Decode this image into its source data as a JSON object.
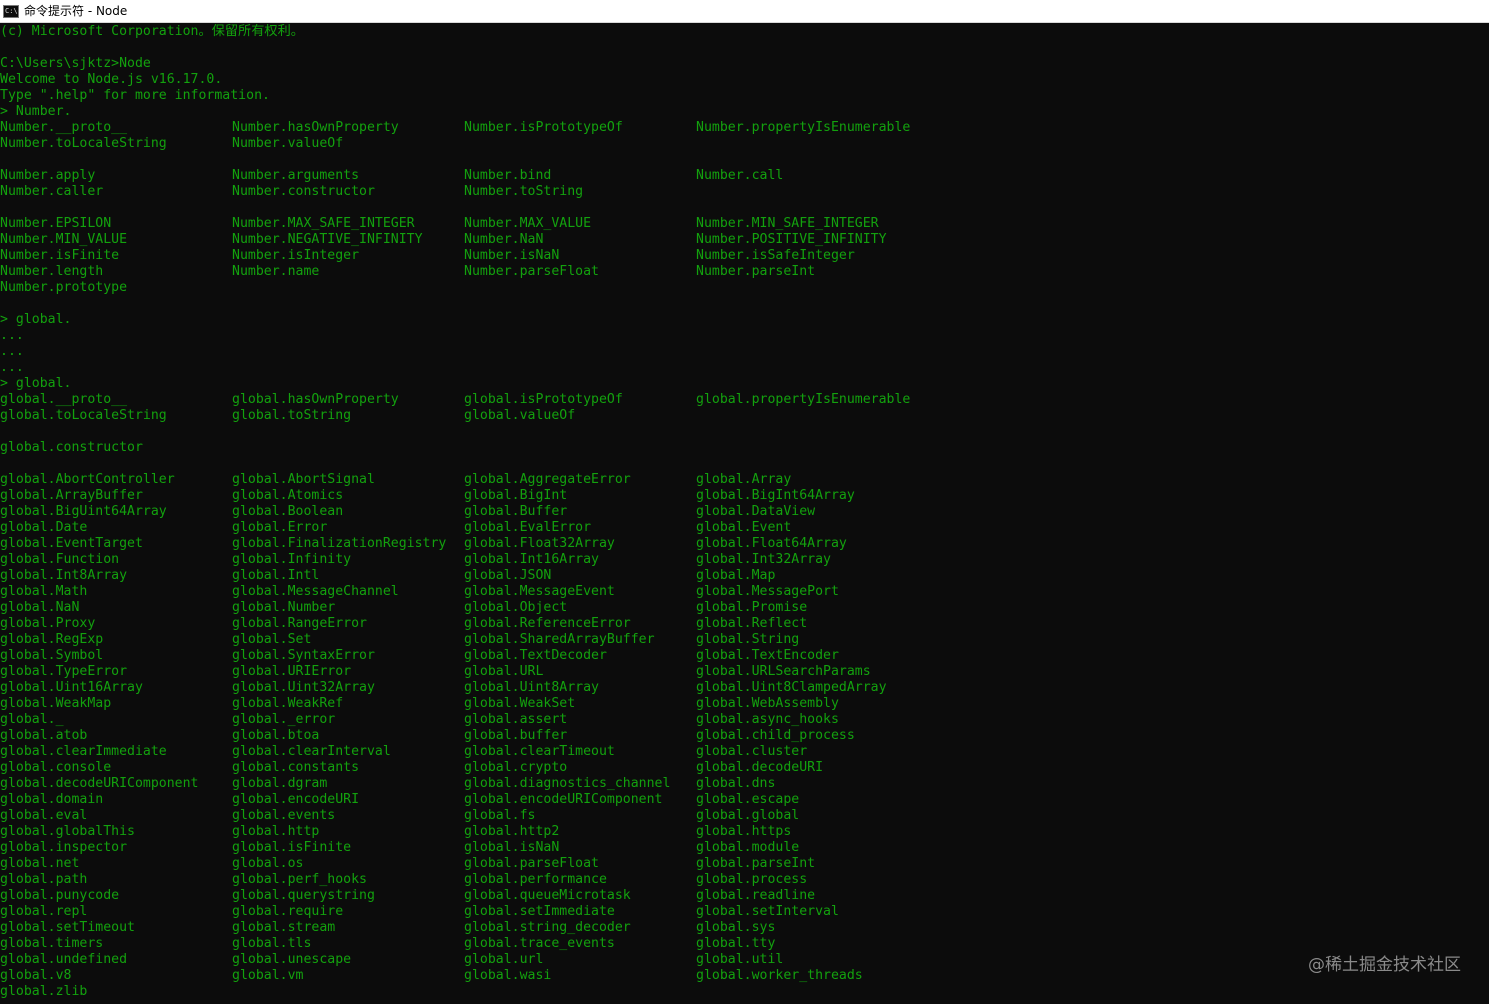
{
  "window": {
    "icon_text": "C:\\",
    "title": "命令提示符 - Node"
  },
  "colors": {
    "terminal_background": "#0c0c0c",
    "terminal_text": "#13a10e",
    "titlebar_background": "#ffffff"
  },
  "console": {
    "lines": [
      [
        "(c) Microsoft Corporation。保留所有权利。"
      ],
      [
        ""
      ],
      [
        "C:\\Users\\sjktz>Node"
      ],
      [
        "Welcome to Node.js v16.17.0."
      ],
      [
        "Type \".help\" for more information."
      ],
      [
        "> Number."
      ],
      [
        "Number.__proto__",
        "Number.hasOwnProperty",
        "Number.isPrototypeOf",
        "Number.propertyIsEnumerable"
      ],
      [
        "Number.toLocaleString",
        "Number.valueOf"
      ],
      [
        ""
      ],
      [
        "Number.apply",
        "Number.arguments",
        "Number.bind",
        "Number.call"
      ],
      [
        "Number.caller",
        "Number.constructor",
        "Number.toString"
      ],
      [
        ""
      ],
      [
        "Number.EPSILON",
        "Number.MAX_SAFE_INTEGER",
        "Number.MAX_VALUE",
        "Number.MIN_SAFE_INTEGER"
      ],
      [
        "Number.MIN_VALUE",
        "Number.NEGATIVE_INFINITY",
        "Number.NaN",
        "Number.POSITIVE_INFINITY"
      ],
      [
        "Number.isFinite",
        "Number.isInteger",
        "Number.isNaN",
        "Number.isSafeInteger"
      ],
      [
        "Number.length",
        "Number.name",
        "Number.parseFloat",
        "Number.parseInt"
      ],
      [
        "Number.prototype"
      ],
      [
        ""
      ],
      [
        "> global."
      ],
      [
        "..."
      ],
      [
        "..."
      ],
      [
        "..."
      ],
      [
        "> global."
      ],
      [
        "global.__proto__",
        "global.hasOwnProperty",
        "global.isPrototypeOf",
        "global.propertyIsEnumerable"
      ],
      [
        "global.toLocaleString",
        "global.toString",
        "global.valueOf"
      ],
      [
        ""
      ],
      [
        "global.constructor"
      ],
      [
        ""
      ],
      [
        "global.AbortController",
        "global.AbortSignal",
        "global.AggregateError",
        "global.Array"
      ],
      [
        "global.ArrayBuffer",
        "global.Atomics",
        "global.BigInt",
        "global.BigInt64Array"
      ],
      [
        "global.BigUint64Array",
        "global.Boolean",
        "global.Buffer",
        "global.DataView"
      ],
      [
        "global.Date",
        "global.Error",
        "global.EvalError",
        "global.Event"
      ],
      [
        "global.EventTarget",
        "global.FinalizationRegistry",
        "global.Float32Array",
        "global.Float64Array"
      ],
      [
        "global.Function",
        "global.Infinity",
        "global.Int16Array",
        "global.Int32Array"
      ],
      [
        "global.Int8Array",
        "global.Intl",
        "global.JSON",
        "global.Map"
      ],
      [
        "global.Math",
        "global.MessageChannel",
        "global.MessageEvent",
        "global.MessagePort"
      ],
      [
        "global.NaN",
        "global.Number",
        "global.Object",
        "global.Promise"
      ],
      [
        "global.Proxy",
        "global.RangeError",
        "global.ReferenceError",
        "global.Reflect"
      ],
      [
        "global.RegExp",
        "global.Set",
        "global.SharedArrayBuffer",
        "global.String"
      ],
      [
        "global.Symbol",
        "global.SyntaxError",
        "global.TextDecoder",
        "global.TextEncoder"
      ],
      [
        "global.TypeError",
        "global.URIError",
        "global.URL",
        "global.URLSearchParams"
      ],
      [
        "global.Uint16Array",
        "global.Uint32Array",
        "global.Uint8Array",
        "global.Uint8ClampedArray"
      ],
      [
        "global.WeakMap",
        "global.WeakRef",
        "global.WeakSet",
        "global.WebAssembly"
      ],
      [
        "global._",
        "global._error",
        "global.assert",
        "global.async_hooks"
      ],
      [
        "global.atob",
        "global.btoa",
        "global.buffer",
        "global.child_process"
      ],
      [
        "global.clearImmediate",
        "global.clearInterval",
        "global.clearTimeout",
        "global.cluster"
      ],
      [
        "global.console",
        "global.constants",
        "global.crypto",
        "global.decodeURI"
      ],
      [
        "global.decodeURIComponent",
        "global.dgram",
        "global.diagnostics_channel",
        "global.dns"
      ],
      [
        "global.domain",
        "global.encodeURI",
        "global.encodeURIComponent",
        "global.escape"
      ],
      [
        "global.eval",
        "global.events",
        "global.fs",
        "global.global"
      ],
      [
        "global.globalThis",
        "global.http",
        "global.http2",
        "global.https"
      ],
      [
        "global.inspector",
        "global.isFinite",
        "global.isNaN",
        "global.module"
      ],
      [
        "global.net",
        "global.os",
        "global.parseFloat",
        "global.parseInt"
      ],
      [
        "global.path",
        "global.perf_hooks",
        "global.performance",
        "global.process"
      ],
      [
        "global.punycode",
        "global.querystring",
        "global.queueMicrotask",
        "global.readline"
      ],
      [
        "global.repl",
        "global.require",
        "global.setImmediate",
        "global.setInterval"
      ],
      [
        "global.setTimeout",
        "global.stream",
        "global.string_decoder",
        "global.sys"
      ],
      [
        "global.timers",
        "global.tls",
        "global.trace_events",
        "global.tty"
      ],
      [
        "global.undefined",
        "global.unescape",
        "global.url",
        "global.util"
      ],
      [
        "global.v8",
        "global.vm",
        "global.wasi",
        "global.worker_threads"
      ],
      [
        "global.zlib"
      ]
    ]
  },
  "watermark": "@稀土掘金技术社区"
}
